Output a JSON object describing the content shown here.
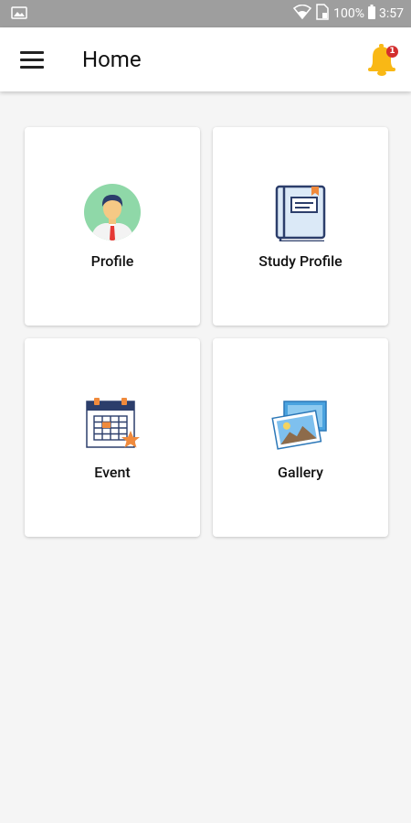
{
  "status_bar": {
    "battery_percent": "100%",
    "time": "3:57",
    "icons": [
      "image-notification-icon",
      "wifi-icon",
      "sim-icon",
      "battery-icon"
    ]
  },
  "app_bar": {
    "title": "Home",
    "notification_count": "1",
    "colors": {
      "bell": "#f9b815",
      "badge": "#d32f2f"
    }
  },
  "tiles": [
    {
      "label": "Profile",
      "icon": "profile-avatar-icon"
    },
    {
      "label": "Study Profile",
      "icon": "book-icon"
    },
    {
      "label": "Event",
      "icon": "calendar-icon"
    },
    {
      "label": "Gallery",
      "icon": "gallery-icon"
    }
  ]
}
